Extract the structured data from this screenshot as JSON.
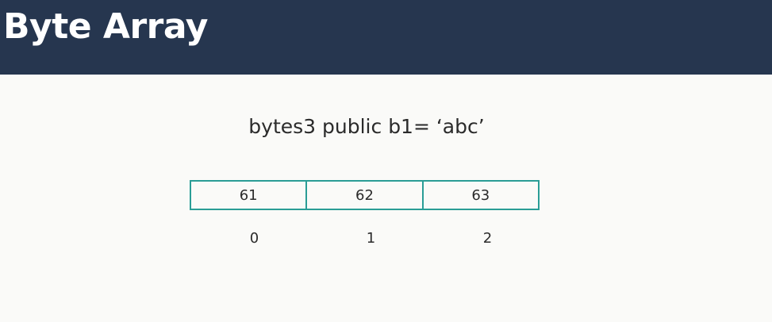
{
  "header": {
    "title": "Byte Array"
  },
  "code": {
    "line": "bytes3 public b1= ‘abc’"
  },
  "array": {
    "cells": [
      "61",
      "62",
      "63"
    ],
    "indices": [
      "0",
      "1",
      "2"
    ]
  },
  "colors": {
    "header_bg": "#26364f",
    "cell_border": "#2a9d96",
    "background": "#fafaf8"
  }
}
